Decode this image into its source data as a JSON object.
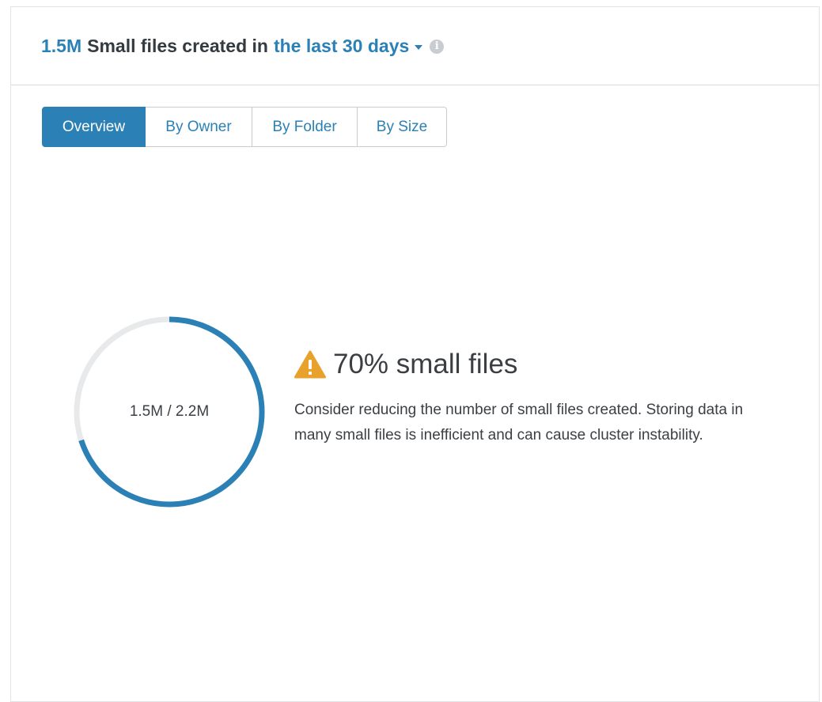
{
  "header": {
    "count": "1.5M",
    "label": "Small files created in",
    "range": "the last 30 days",
    "icons": {
      "dropdown": "caret-down-icon",
      "info": "info-icon"
    }
  },
  "tabs": [
    {
      "label": "Overview",
      "active": true
    },
    {
      "label": "By Owner",
      "active": false
    },
    {
      "label": "By Folder",
      "active": false
    },
    {
      "label": "By Size",
      "active": false
    }
  ],
  "gauge": {
    "label": "1.5M / 2.2M",
    "fraction": 0.7
  },
  "summary": {
    "icon": "warning-icon",
    "title": "70% small files",
    "description": "Consider reducing the number of small files created. Storing data in many small files is inefficient and can cause cluster instability."
  },
  "colors": {
    "accent": "#2b80b5",
    "track": "#e8e9ea",
    "warning": "#e8a12b"
  }
}
